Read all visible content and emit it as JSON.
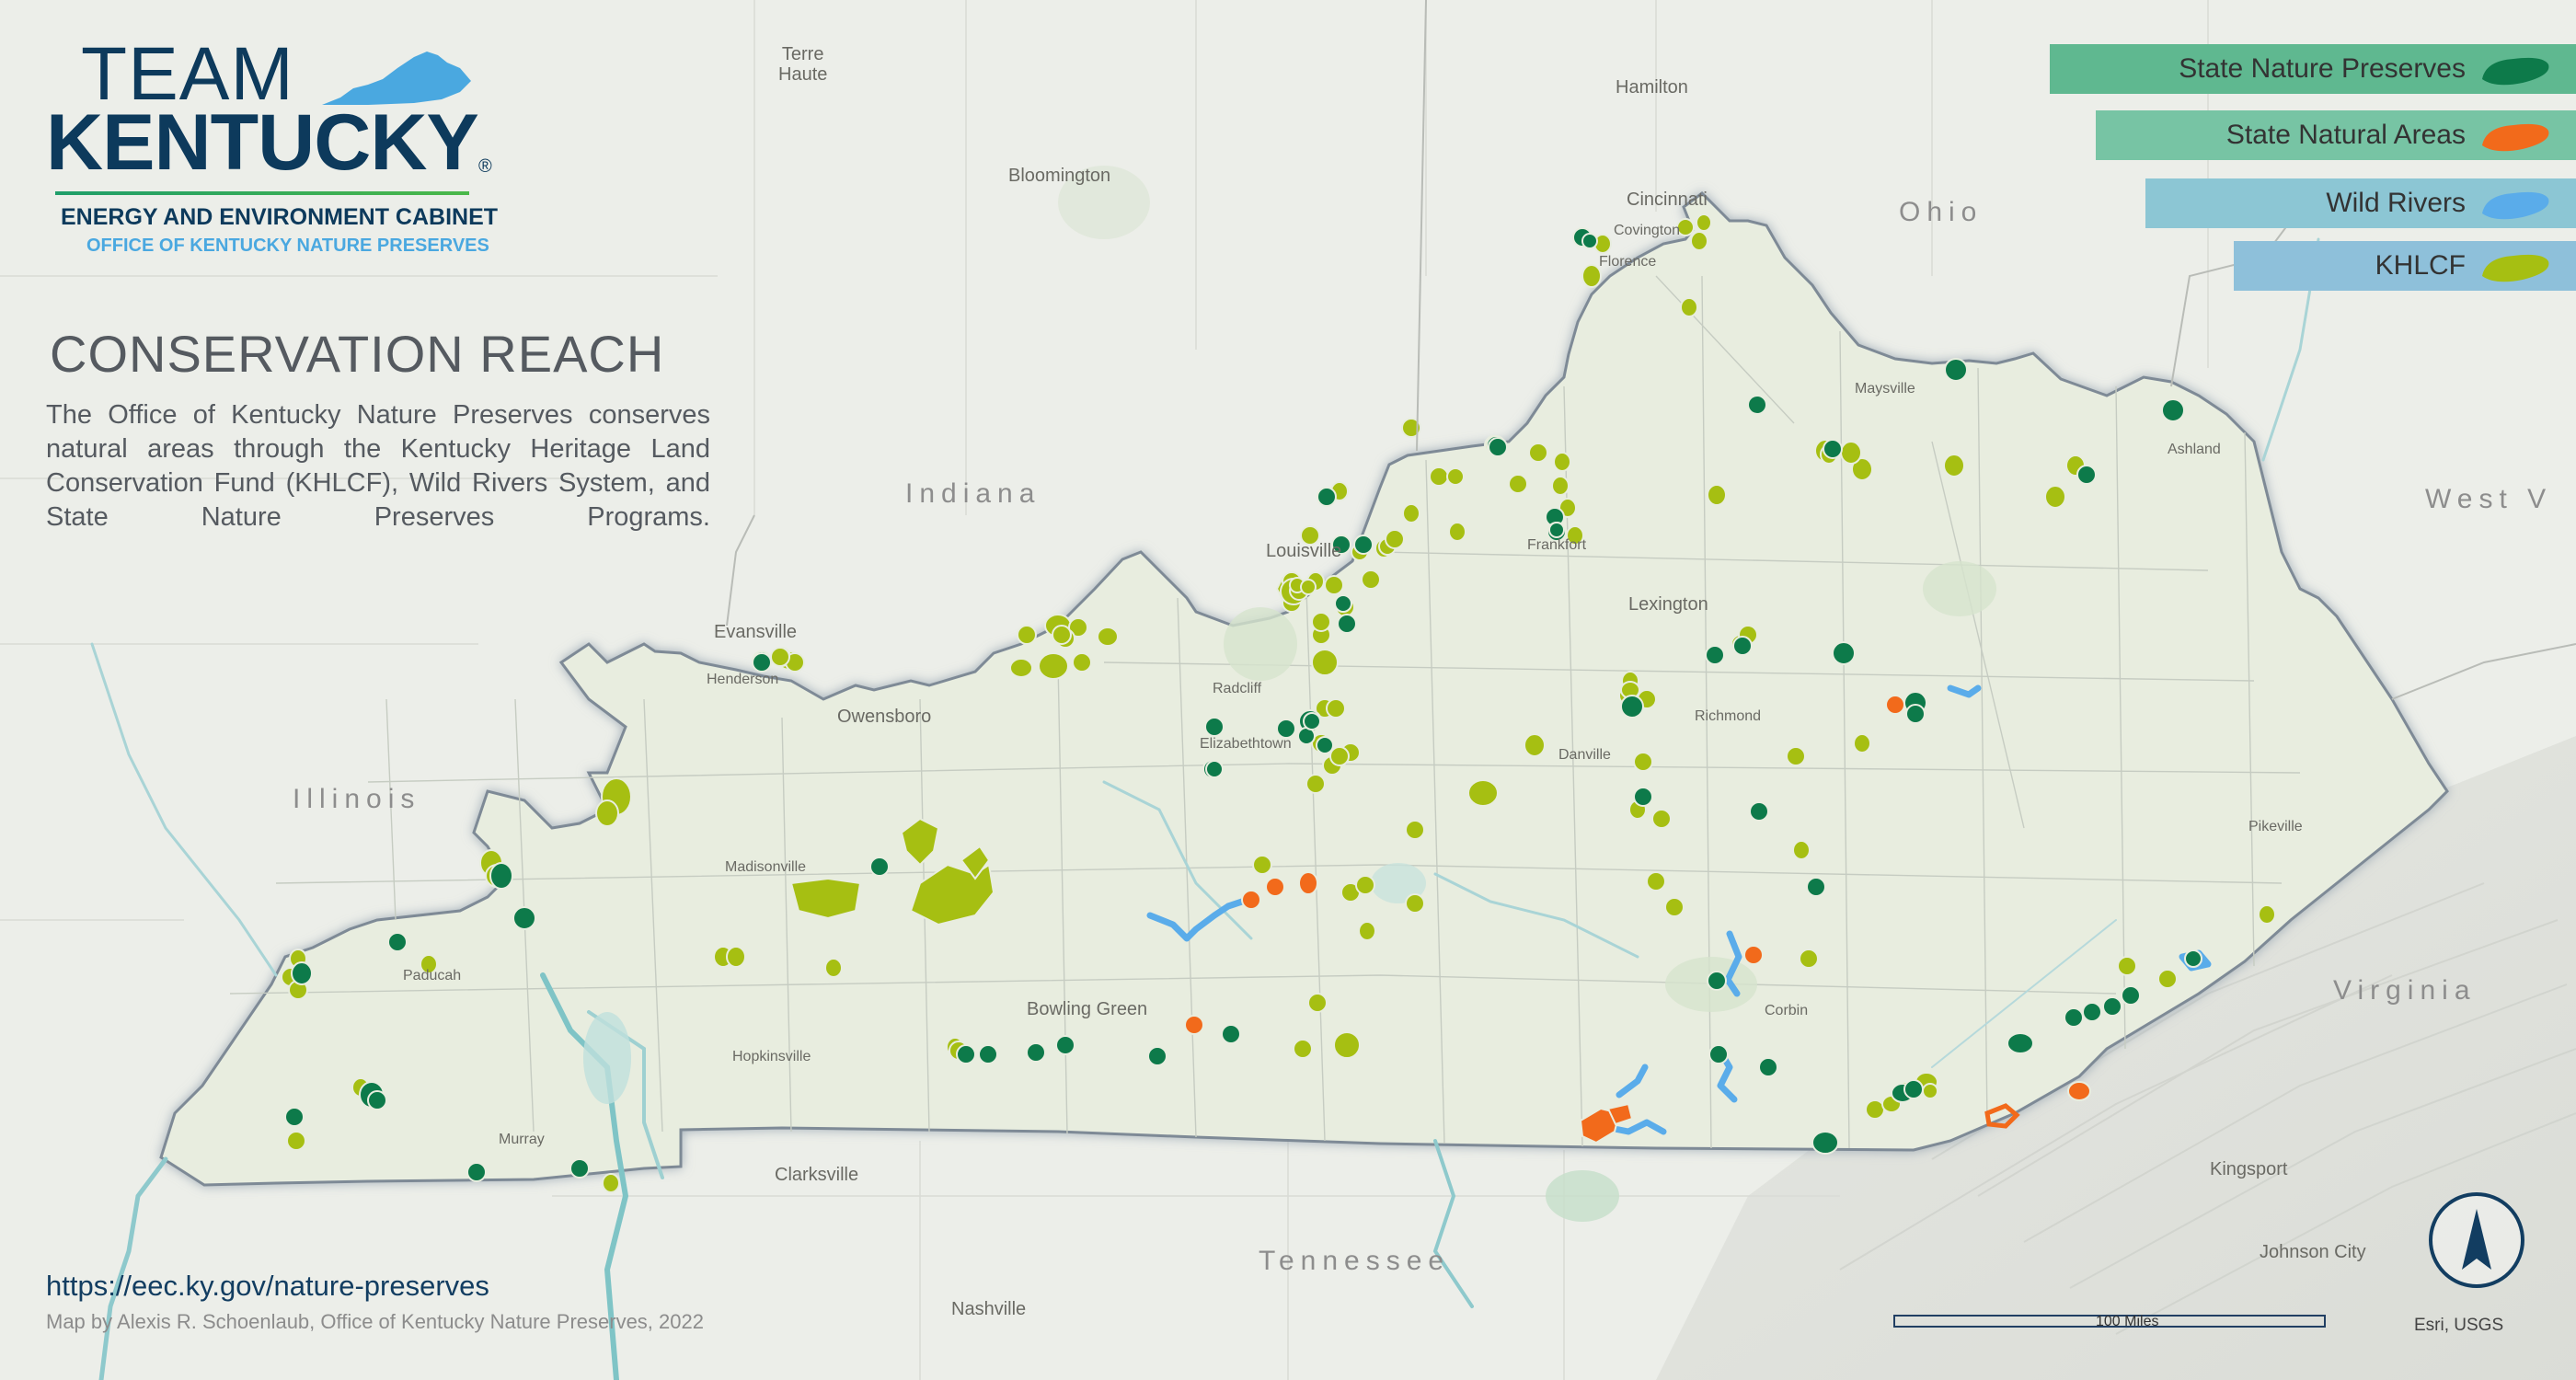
{
  "logo": {
    "team": "TEAM",
    "kentucky": "KENTUCKY",
    "registered": "®",
    "cabinet": "ENERGY AND ENVIRONMENT CABINET",
    "office": "OFFICE OF KENTUCKY NATURE PRESERVES"
  },
  "title": "CONSERVATION REACH",
  "description": "The Office of Kentucky Nature Preserves conserves natural areas through the Kentucky Heritage Land Conservation Fund (KHLCF), Wild Rivers System, and State Nature Preserves Programs.",
  "url": "https://eec.ky.gov/nature-preserves",
  "credit": "Map by Alexis R. Schoenlaub, Office of Kentucky Nature Preserves, 2022",
  "scale": {
    "label": "100 Miles"
  },
  "attribution": "Esri, USGS",
  "north_arrow": "north-arrow-icon",
  "legend": [
    {
      "label": "State Nature Preserves",
      "color": "#0d7a4a",
      "bg": "#5fb890"
    },
    {
      "label": "State Natural Areas",
      "color": "#f26a1b",
      "bg": "#77c4a4"
    },
    {
      "label": "Wild Rivers",
      "color": "#5aacea",
      "bg": "#8cc6d4"
    },
    {
      "label": "KHLCF",
      "color": "#a6bf12",
      "bg": "#8ec0da"
    }
  ],
  "state_labels": {
    "indiana": "Indiana",
    "illinois": "Illinois",
    "ohio": "Ohio",
    "west_virginia": "West V",
    "virginia": "Virginia",
    "tennessee": "Tennessee"
  },
  "cities": {
    "terre_haute_1": "Terre",
    "terre_haute_2": "Haute",
    "hamilton": "Hamilton",
    "bloomington": "Bloomington",
    "cincinnati": "Cincinnati",
    "covington": "Covington",
    "florence": "Florence",
    "maysville": "Maysville",
    "ashland": "Ashland",
    "louisville": "Louisville",
    "frankfort": "Frankfort",
    "lexington": "Lexington",
    "evansville": "Evansville",
    "henderson": "Henderson",
    "owensboro": "Owensboro",
    "radcliff": "Radcliff",
    "elizabethtown": "Elizabethtown",
    "richmond": "Richmond",
    "danville": "Danville",
    "pikeville": "Pikeville",
    "madisonville": "Madisonville",
    "paducah": "Paducah",
    "bowling_green": "Bowling Green",
    "hopkinsville": "Hopkinsville",
    "corbin": "Corbin",
    "murray": "Murray",
    "clarksville": "Clarksville",
    "kingsport": "Kingsport",
    "johnson_city": "Johnson City",
    "nashville": "Nashville"
  }
}
